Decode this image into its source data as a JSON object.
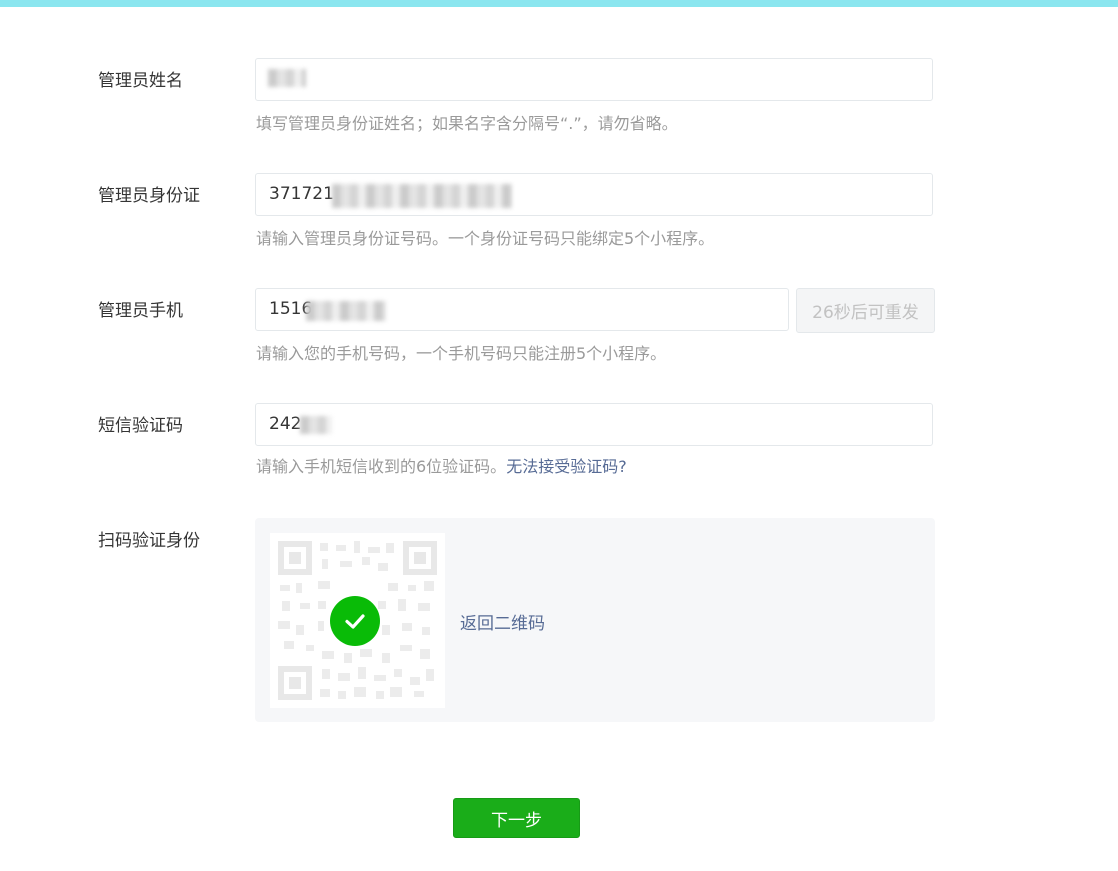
{
  "form": {
    "name": {
      "label": "管理员姓名",
      "value": "",
      "hint": "填写管理员身份证姓名；如果名字含分隔号“.”，请勿省略。"
    },
    "id_card": {
      "label": "管理员身份证",
      "value": "371721",
      "hint": "请输入管理员身份证号码。一个身份证号码只能绑定5个小程序。"
    },
    "phone": {
      "label": "管理员手机",
      "value": "1516",
      "resend_label": "26秒后可重发",
      "hint": "请输入您的手机号码，一个手机号码只能注册5个小程序。"
    },
    "sms_code": {
      "label": "短信验证码",
      "value": "242",
      "hint": "请输入手机短信收到的6位验证码。",
      "hint_link": "无法接受验证码?"
    },
    "scan": {
      "label": "扫码验证身份",
      "back_link": "返回二维码"
    }
  },
  "actions": {
    "next_label": "下一步"
  },
  "colors": {
    "accent_green": "#1aad19",
    "success_green": "#09bb07",
    "link_blue": "#576b95",
    "top_bar": "#8be6ef"
  },
  "icons": {
    "qr": "qr-code-icon",
    "success": "check-circle-icon"
  }
}
